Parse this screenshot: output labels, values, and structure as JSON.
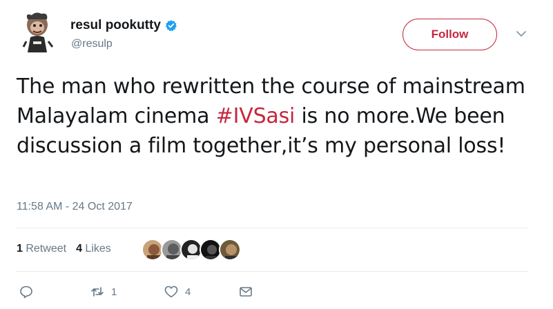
{
  "author": {
    "display_name": "resul pookutty",
    "handle": "@resulp",
    "verified": true
  },
  "follow_label": "Follow",
  "tweet": {
    "text_before": "The man who rewritten the course of mainstream Malayalam cinema ",
    "hashtag": "#IVSasi",
    "text_after": " is no more.We been discussion a film together,it’s my personal loss!"
  },
  "timestamp": "11:58 AM - 24 Oct 2017",
  "stats": {
    "retweets_count": "1",
    "retweets_label": "Retweet",
    "likes_count": "4",
    "likes_label": "Likes"
  },
  "actions": {
    "retweet_count": "1",
    "like_count": "4"
  },
  "colors": {
    "accent": "#c5283d",
    "secondary_text": "#657786",
    "verified_blue": "#1da1f2",
    "divider": "#e6ecf0"
  },
  "icons": {
    "reply": "reply-icon",
    "retweet": "retweet-icon",
    "like": "heart-icon",
    "message": "envelope-icon",
    "more": "chevron-down-icon",
    "verified": "verified-badge-icon"
  }
}
